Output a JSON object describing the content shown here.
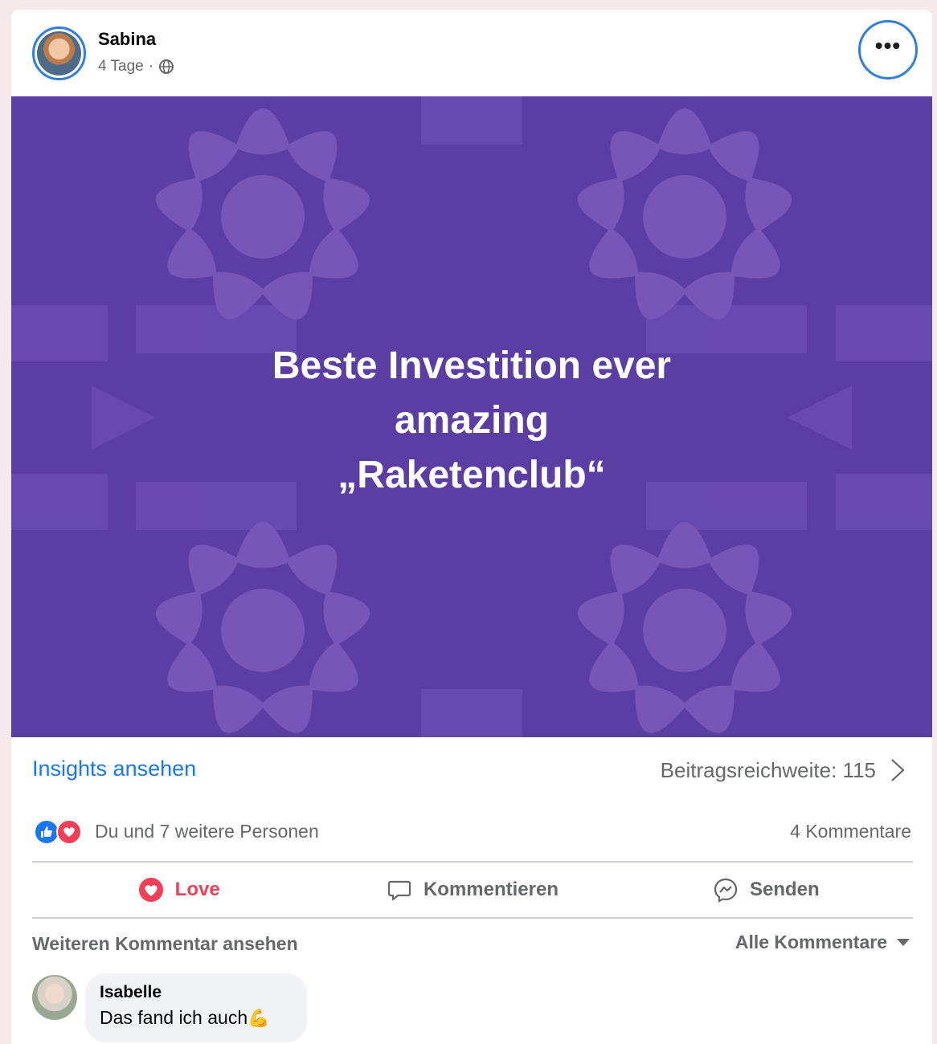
{
  "post": {
    "author": "Sabina",
    "time": "4 Tage",
    "separator": "·",
    "audience_icon": "globe-icon",
    "more_icon": "more-dots-icon",
    "more_label": "•••"
  },
  "media": {
    "lines": [
      "Beste Investition ever",
      "amazing",
      "„Raketenclub“"
    ],
    "background_color": "#5b3ea3",
    "pattern_color": "#7656b8"
  },
  "insights": {
    "link_label": "Insights ansehen",
    "reach_label": "Beitragsreichweite: 115",
    "chevron_icon": "chevron-right-icon"
  },
  "reactions": {
    "icons": [
      "like-icon",
      "love-icon"
    ],
    "summary": "Du und 7 weitere Personen",
    "comments_count": "4 Kommentare"
  },
  "actions": {
    "love": "Love",
    "comment": "Kommentieren",
    "send": "Senden"
  },
  "comments": {
    "view_more": "Weiteren Kommentar ansehen",
    "filter_label": "Alle Kommentare",
    "items": [
      {
        "name": "Isabelle",
        "text": "Das fand ich auch",
        "emoji": "💪"
      }
    ]
  },
  "colors": {
    "accent_blue": "#1877f2",
    "love_red": "#f33e58",
    "muted_text": "#65676b"
  }
}
